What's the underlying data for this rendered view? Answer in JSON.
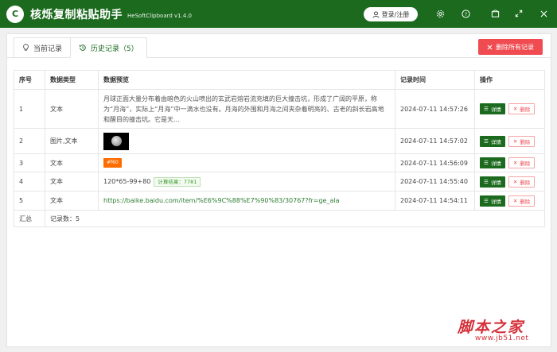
{
  "app": {
    "logo": "C",
    "title": "核烁复制粘贴助手",
    "subtitle": "HeSoftClipboard v1.4.0",
    "login_label": "登录/注册"
  },
  "tabs": [
    {
      "label": "当前记录"
    },
    {
      "label": "历史记录（5）"
    }
  ],
  "clear_all_label": "删除所有记录",
  "table": {
    "headers": [
      "序号",
      "数据类型",
      "数据预览",
      "记录时间",
      "操作"
    ],
    "rows": [
      {
        "index": "1",
        "type": "文本",
        "preview": "月球正面大量分布着由暗色的火山喷出的玄武岩熔岩流充填的巨大撞击坑，形成了广阔的平原，称为“月海”，实际上“月海”中一滴水也没有。月海的外围和月海之间夹杂着明亮的、古老的斜长岩高地和醒目的撞击坑。它是天...",
        "time": "2024-07-11 14:57:26"
      },
      {
        "index": "2",
        "type": "图片,文本",
        "preview": "",
        "time": "2024-07-11 14:57:02"
      },
      {
        "index": "3",
        "type": "文本",
        "preview": "#f60",
        "time": "2024-07-11 14:56:09"
      },
      {
        "index": "4",
        "type": "文本",
        "preview": "120*65-99+80",
        "calc": "计算结果：7781",
        "time": "2024-07-11 14:55:40"
      },
      {
        "index": "5",
        "type": "文本",
        "preview": "https://baike.baidu.com/item/%E6%9C%88%E7%90%83/30767?fr=ge_ala",
        "time": "2024-07-11 14:54:11"
      }
    ],
    "detail_label": "详情",
    "delete_label": "删除",
    "summary_label": "汇总",
    "summary_count": "记录数：5"
  },
  "watermark": {
    "main": "脚本之家",
    "url": "www.jb51.net"
  },
  "colors": {
    "brand": "#1b6a1e",
    "danger": "#ef4b51",
    "chip": "#ff6d00"
  }
}
